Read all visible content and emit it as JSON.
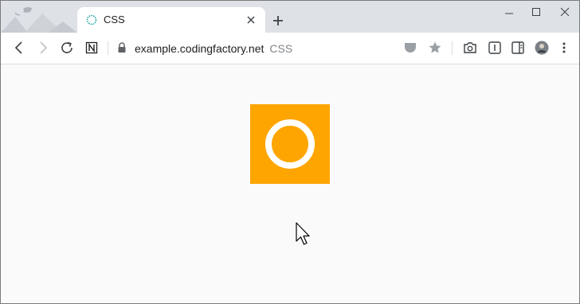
{
  "tab": {
    "title": "CSS",
    "close_icon": "close-icon"
  },
  "window_controls": [
    "minimize-icon",
    "maximize-icon",
    "close-icon"
  ],
  "toolbar": {
    "url_host": "example.codingfactory.net",
    "url_title": "CSS"
  },
  "content": {
    "box_color": "#ffa500",
    "ring_color": "#ffffff"
  }
}
